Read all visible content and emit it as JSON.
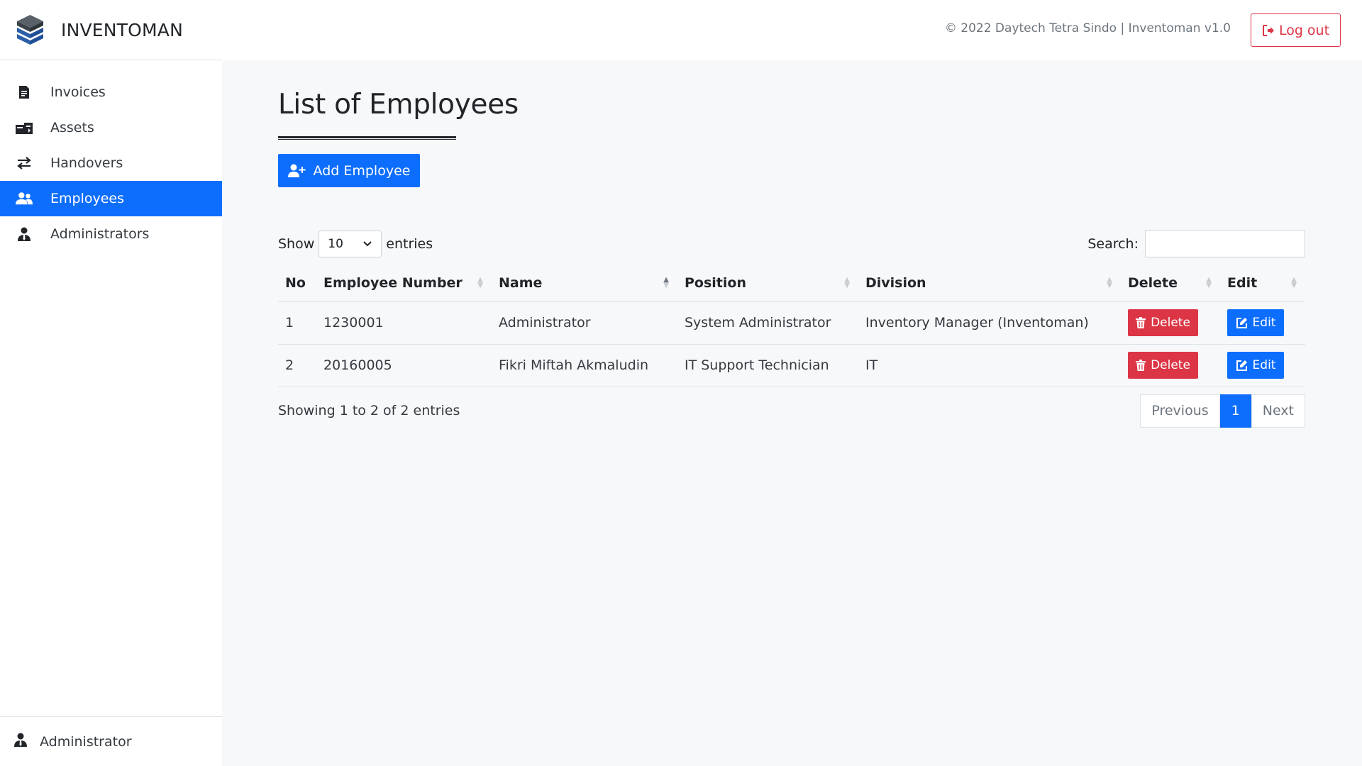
{
  "app": {
    "name": "INVENTOMAN",
    "copyright": "© 2022 Daytech Tetra Sindo | Inventoman v1.0",
    "logout_label": "Log out"
  },
  "sidebar": {
    "items": [
      {
        "label": "Invoices",
        "icon": "invoice-icon"
      },
      {
        "label": "Assets",
        "icon": "assets-icon"
      },
      {
        "label": "Handovers",
        "icon": "exchange-icon"
      },
      {
        "label": "Employees",
        "icon": "users-icon",
        "active": true
      },
      {
        "label": "Administrators",
        "icon": "user-tie-icon"
      }
    ],
    "footer_user": "Administrator"
  },
  "main": {
    "title": "List of Employees",
    "add_button": "Add Employee",
    "show_label": "Show",
    "entries_value": "10",
    "entries_label": "entries",
    "search_label": "Search:",
    "search_value": "",
    "columns": [
      "No",
      "Employee Number",
      "Name",
      "Position",
      "Division",
      "Delete",
      "Edit"
    ],
    "rows": [
      {
        "no": "1",
        "employee_number": "1230001",
        "name": "Administrator",
        "position": "System Administrator",
        "division": "Inventory Manager (Inventoman)"
      },
      {
        "no": "2",
        "employee_number": "20160005",
        "name": "Fikri Miftah Akmaludin",
        "position": "IT Support Technician",
        "division": "IT"
      }
    ],
    "delete_label": "Delete",
    "edit_label": "Edit",
    "info": "Showing 1 to 2 of 2 entries",
    "pagination": {
      "previous": "Previous",
      "current": "1",
      "next": "Next"
    }
  },
  "colors": {
    "primary": "#0d6efd",
    "danger": "#dc3545"
  }
}
